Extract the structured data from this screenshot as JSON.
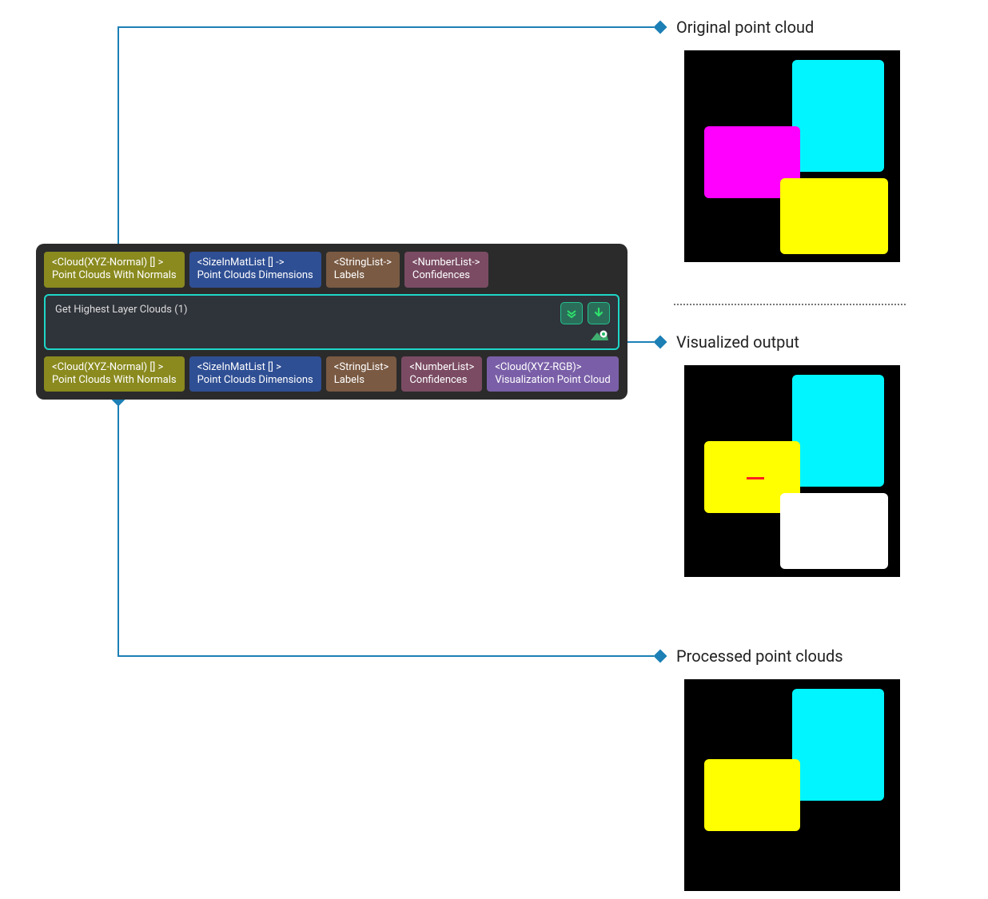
{
  "annotations": {
    "original": "Original point cloud",
    "visualized": "Visualized output",
    "processed": "Processed point clouds"
  },
  "node": {
    "title": "Get Highest Layer Clouds (1)",
    "inputs": [
      {
        "type": "<Cloud(XYZ-Normal) [] >",
        "label": "Point Clouds With Normals",
        "color": "olive"
      },
      {
        "type": "<SizeInMatList [] ->",
        "label": "Point Clouds Dimensions",
        "color": "blue"
      },
      {
        "type": "<StringList->",
        "label": "Labels",
        "color": "brown"
      },
      {
        "type": "<NumberList->",
        "label": "Confidences",
        "color": "plum"
      }
    ],
    "outputs": [
      {
        "type": "<Cloud(XYZ-Normal) [] >",
        "label": "Point Clouds With Normals",
        "color": "olive"
      },
      {
        "type": "<SizeInMatList [] >",
        "label": "Point Clouds Dimensions",
        "color": "blue"
      },
      {
        "type": "<StringList>",
        "label": "Labels",
        "color": "brown"
      },
      {
        "type": "<NumberList>",
        "label": "Confidences",
        "color": "plum"
      },
      {
        "type": "<Cloud(XYZ-RGB)>",
        "label": "Visualization Point Cloud",
        "color": "purple"
      }
    ]
  }
}
